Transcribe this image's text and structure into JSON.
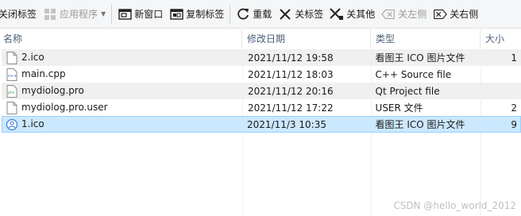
{
  "toolbar": {
    "close_tabs": "关闭标签",
    "apps": "应用程序",
    "new_window": "新窗口",
    "copy_tab": "复制标签",
    "reload": "重载",
    "close_tab": "关标签",
    "close_others": "关其他",
    "close_left": "关左侧",
    "close_right": "关右侧"
  },
  "columns": {
    "name": "名称",
    "date": "修改日期",
    "type": "类型",
    "size": "大小"
  },
  "files": [
    {
      "name": "2.ico",
      "date": "2021/11/12 19:58",
      "type": "看图王 ICO 图片文件",
      "size": "1",
      "icon": "ico-file-icon"
    },
    {
      "name": "main.cpp",
      "date": "2021/11/12 18:03",
      "type": "C++ Source file",
      "size": "",
      "icon": "cpp-file-icon"
    },
    {
      "name": "mydiolog.pro",
      "date": "2021/11/12 20:16",
      "type": "Qt Project file",
      "size": "",
      "icon": "pro-file-icon"
    },
    {
      "name": "mydiolog.pro.user",
      "date": "2021/11/12 17:22",
      "type": "USER 文件",
      "size": "2",
      "icon": "generic-file-icon"
    },
    {
      "name": "1.ico",
      "date": "2021/11/3 10:35",
      "type": "看图王 ICO 图片文件",
      "size": "9",
      "icon": "ico-image-icon"
    }
  ],
  "watermark": "CSDN @hello_world_2012",
  "colors": {
    "selected_bg": "#cce8ff",
    "selected_border": "#99d1ff",
    "header_text": "#4c607a"
  }
}
